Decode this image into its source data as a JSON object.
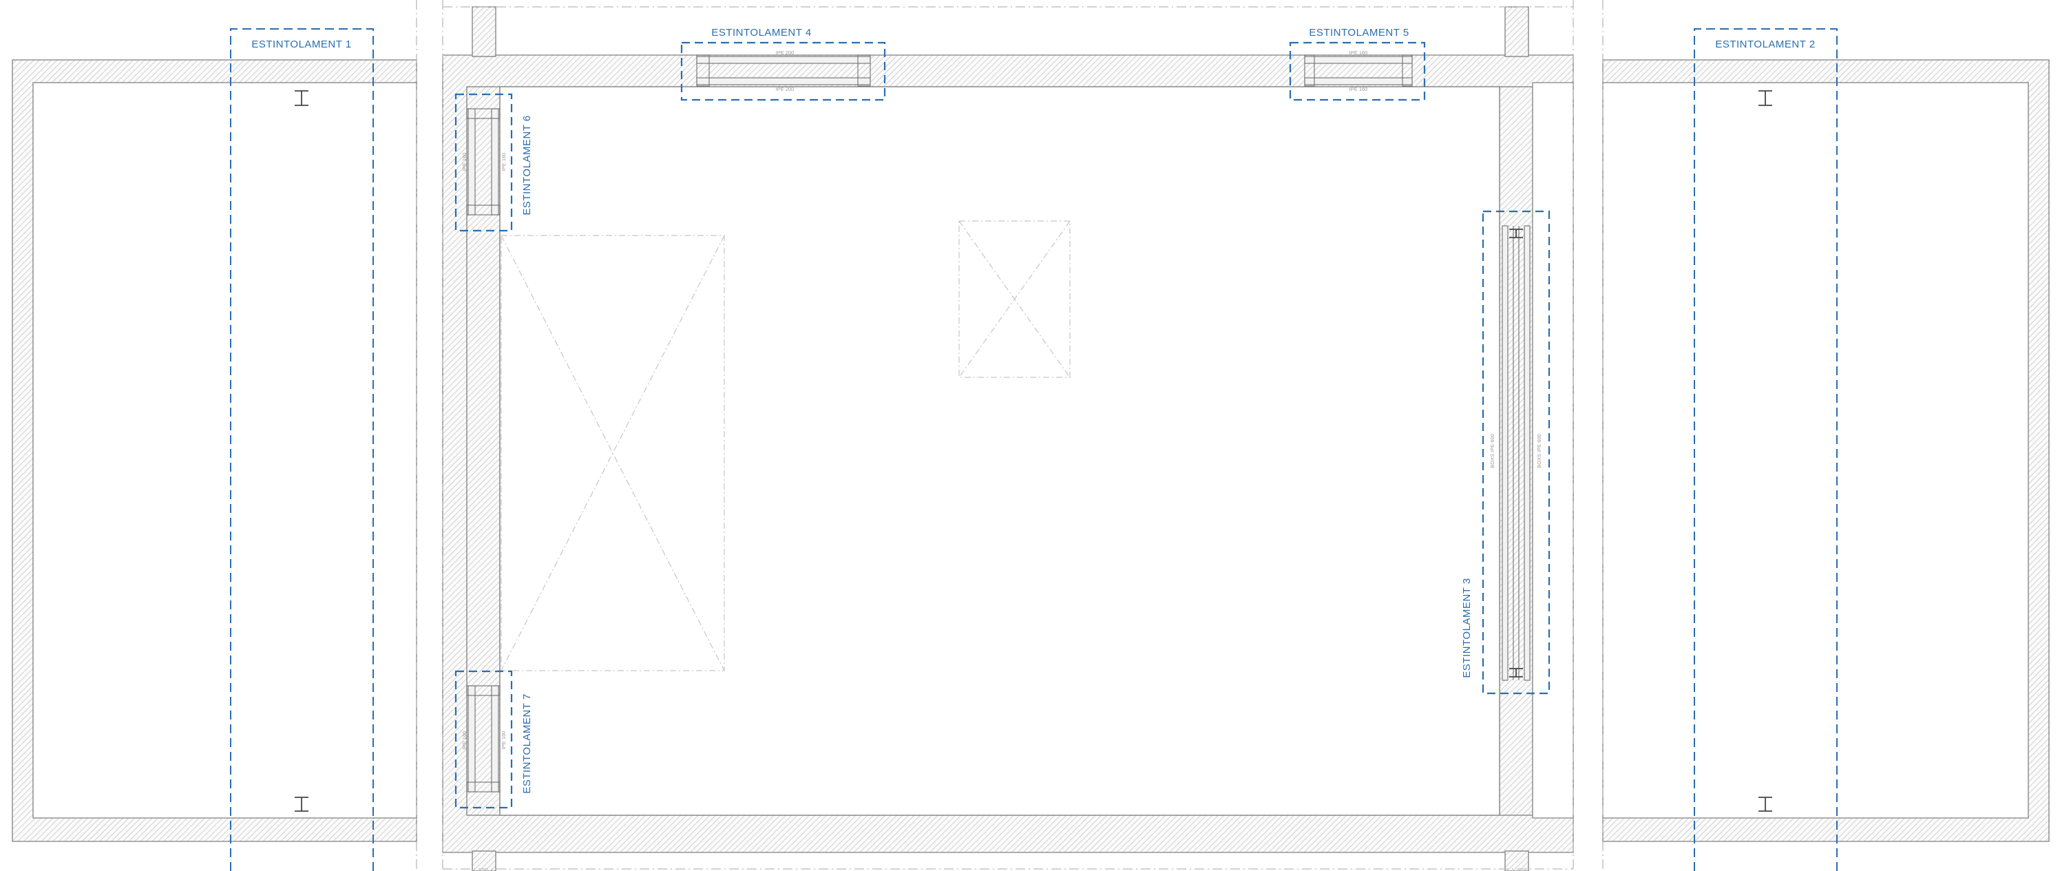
{
  "drawing": {
    "labels": {
      "e1": "ESTINTOLAMENT 1",
      "e2": "ESTINTOLAMENT 2",
      "e3": "ESTINTOLAMENT 3",
      "e4": "ESTINTOLAMENT 4",
      "e5": "ESTINTOLAMENT 5",
      "e6": "ESTINTOLAMENT 6",
      "e7": "ESTINTOLAMENT 7"
    },
    "profiles": {
      "e3": "BOXS IPE 600",
      "e4": "IPE 200",
      "e5": "IPE 160",
      "e6": "IPE 160",
      "e7": "IPE 160"
    },
    "colors": {
      "annotation": "#2a6db0",
      "wall_stroke": "#7f7f7f",
      "hatch": "#bdbdbd",
      "guides": "#b9b9b9"
    }
  }
}
